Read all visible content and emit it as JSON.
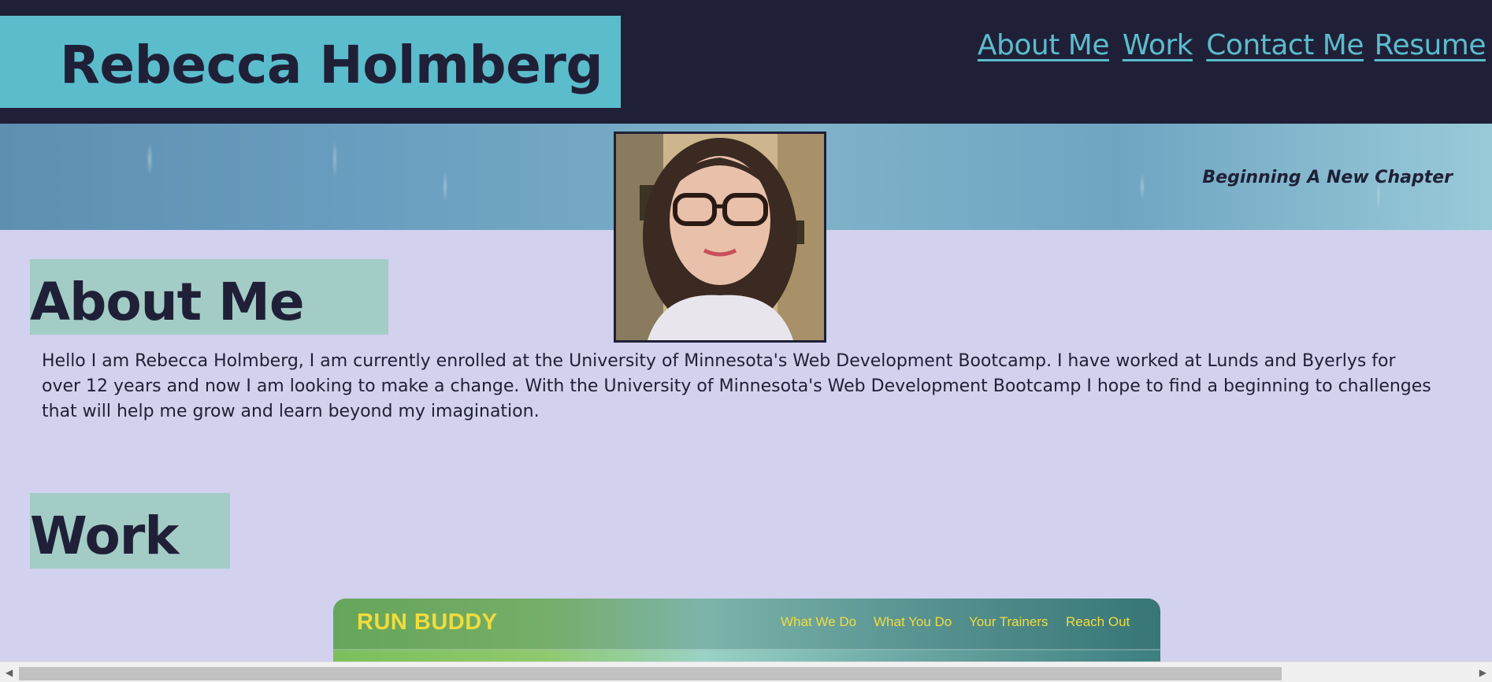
{
  "header": {
    "name": "Rebecca Holmberg",
    "nav": [
      "About Me",
      "Work",
      "Contact Me",
      "Resume"
    ]
  },
  "hero": {
    "tagline": "Beginning A New Chapter"
  },
  "about": {
    "title": "About Me",
    "text": "Hello I am Rebecca Holmberg, I am currently enrolled at the University of Minnesota's Web Development Bootcamp. I have worked at Lunds and Byerlys for over 12 years and now I am looking to make a change. With the University of Minnesota's Web Development Bootcamp I hope to find a beginning to challenges that will help me grow and learn beyond my imagination."
  },
  "work": {
    "title": "Work",
    "project": {
      "logo": "RUN BUDDY",
      "nav": [
        "What We Do",
        "What You Do",
        "Your Trainers",
        "Reach Out"
      ]
    }
  },
  "colors": {
    "header_bg": "#1f2037",
    "accent": "#5bbccc",
    "page_bg": "#d2d1ee",
    "section_title_bg": "#a3ccc6",
    "project_text": "#f2dc3c"
  },
  "icons": {
    "scroll_left": "arrow-left-icon",
    "scroll_right": "arrow-right-icon"
  }
}
